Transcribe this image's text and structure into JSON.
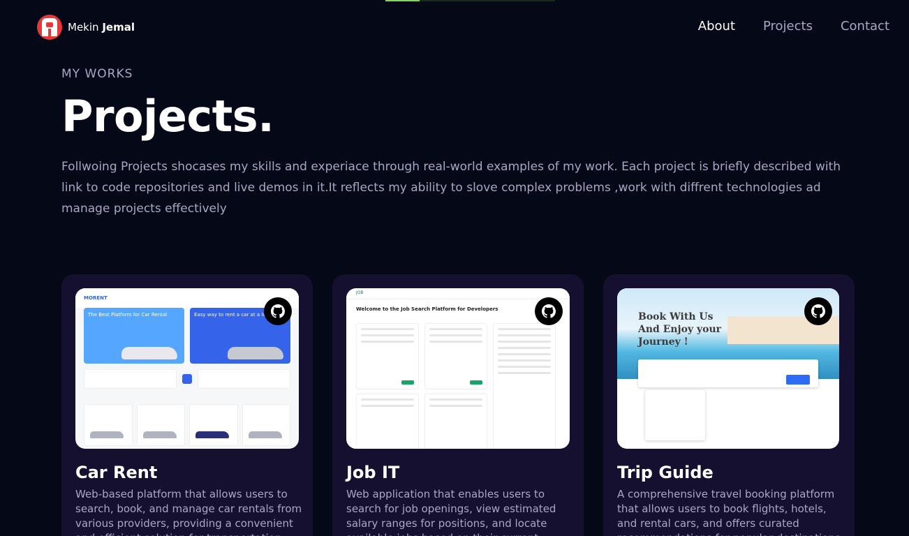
{
  "scroll_progress": 0.2,
  "brand": {
    "first": "Mekin",
    "last": "Jemal"
  },
  "nav": {
    "items": [
      "About",
      "Projects",
      "Contact"
    ],
    "active": "About"
  },
  "header": {
    "subtitle": "MY WORKS",
    "title": "Projects.",
    "intro": "Follwoing Projects shocases my skills and experiace through real-world examples of my work. Each project is briefly described with link to code repositories and live demos in it.It reflects my ability to slove complex problems ,work with diffrent technologies ad manage projects effectively"
  },
  "projects": [
    {
      "name": "Car Rent",
      "description": "Web-based platform that allows users to search, book, and manage car rentals from various providers, providing a convenient and efficient solution for transportation needs.",
      "preview": {
        "brand": "MORENT",
        "banner1": "The Best Platform for Car Rental",
        "banner2": "Easy way to rent a car at a low price"
      }
    },
    {
      "name": "Job IT",
      "description": "Web application that enables users to search for job openings, view estimated salary ranges for positions, and locate available jobs based on their current location.",
      "preview": {
        "brand": "JOB",
        "heading": "Welcome to the Job Search Platform for Developers"
      }
    },
    {
      "name": "Trip Guide",
      "description": "A comprehensive travel booking platform that allows users to book flights, hotels, and rental cars, and offers curated recommendations for popular destinations.",
      "preview": {
        "headline": [
          "Book With Us",
          "And Enjoy your",
          "Journey !"
        ]
      }
    }
  ],
  "icons": {
    "github": "github-icon"
  }
}
